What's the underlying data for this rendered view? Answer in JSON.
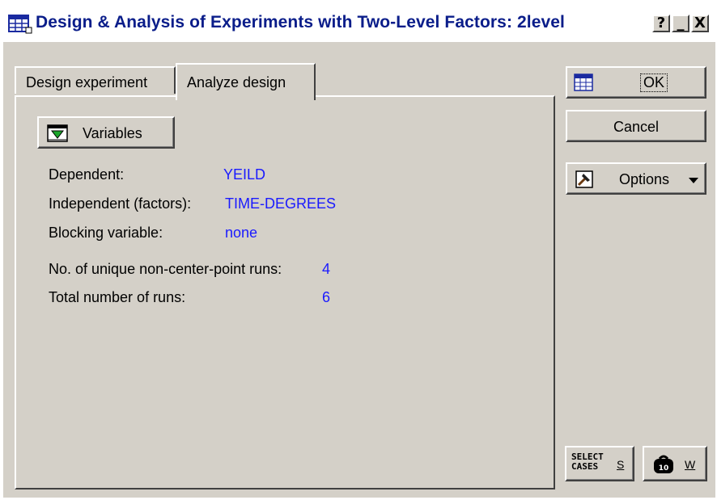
{
  "window": {
    "title": "Design & Analysis of Experiments with Two-Level Factors: 2level",
    "help_btn": "?",
    "minimize_btn": "_",
    "close_btn": "X"
  },
  "tabs": [
    {
      "label": "Design experiment",
      "active": false
    },
    {
      "label": "Analyze design",
      "active": true
    }
  ],
  "panel": {
    "variables_button": "Variables",
    "rows": [
      {
        "label": "Dependent:",
        "value": "YEILD"
      },
      {
        "label": "Independent (factors):",
        "value": "TIME-DEGREES"
      },
      {
        "label": "Blocking variable:",
        "value": "none"
      },
      {
        "label": "No. of unique non-center-point runs:",
        "value": "4"
      },
      {
        "label": "Total number of runs:",
        "value": "6"
      }
    ]
  },
  "buttons": {
    "ok": "OK",
    "cancel": "Cancel",
    "options": "Options",
    "select_cases_icon_line1": "SELECT",
    "select_cases_icon_line2": "CASES",
    "select_cases_key": "S",
    "w_key": "W"
  },
  "colors": {
    "value_blue": "#1a1aff",
    "title_blue": "#0a1d8a",
    "face": "#d4d0c8"
  }
}
